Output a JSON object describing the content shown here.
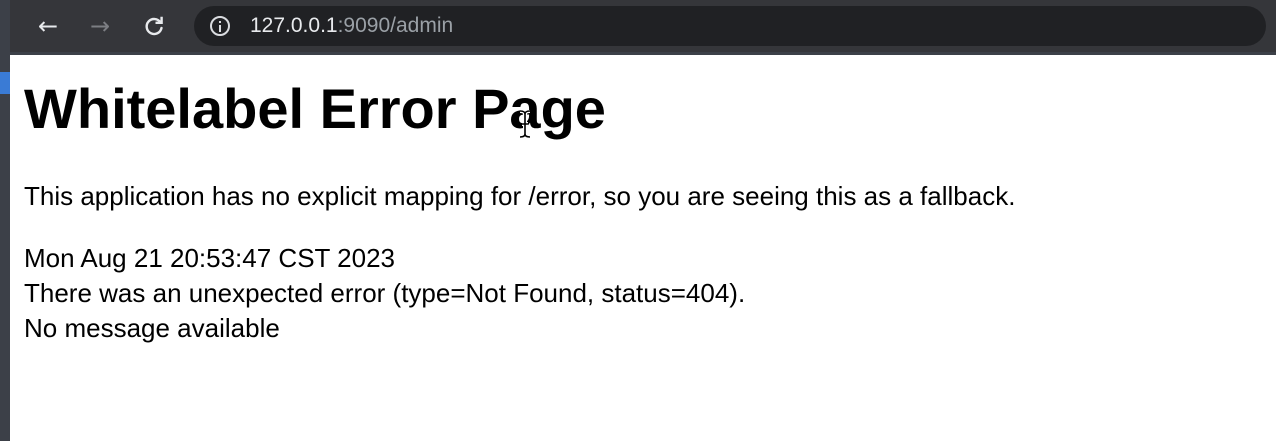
{
  "browser": {
    "url_host": "127.0.0.1",
    "url_rest": ":9090/admin",
    "back_icon": "←",
    "forward_icon": "→",
    "reload_icon": "C"
  },
  "page": {
    "title": "Whitelabel Error Page",
    "description": "This application has no explicit mapping for /error, so you are seeing this as a fallback.",
    "timestamp": "Mon Aug 21 20:53:47 CST 2023",
    "error_detail": "There was an unexpected error (type=Not Found, status=404).",
    "message": "No message available"
  }
}
